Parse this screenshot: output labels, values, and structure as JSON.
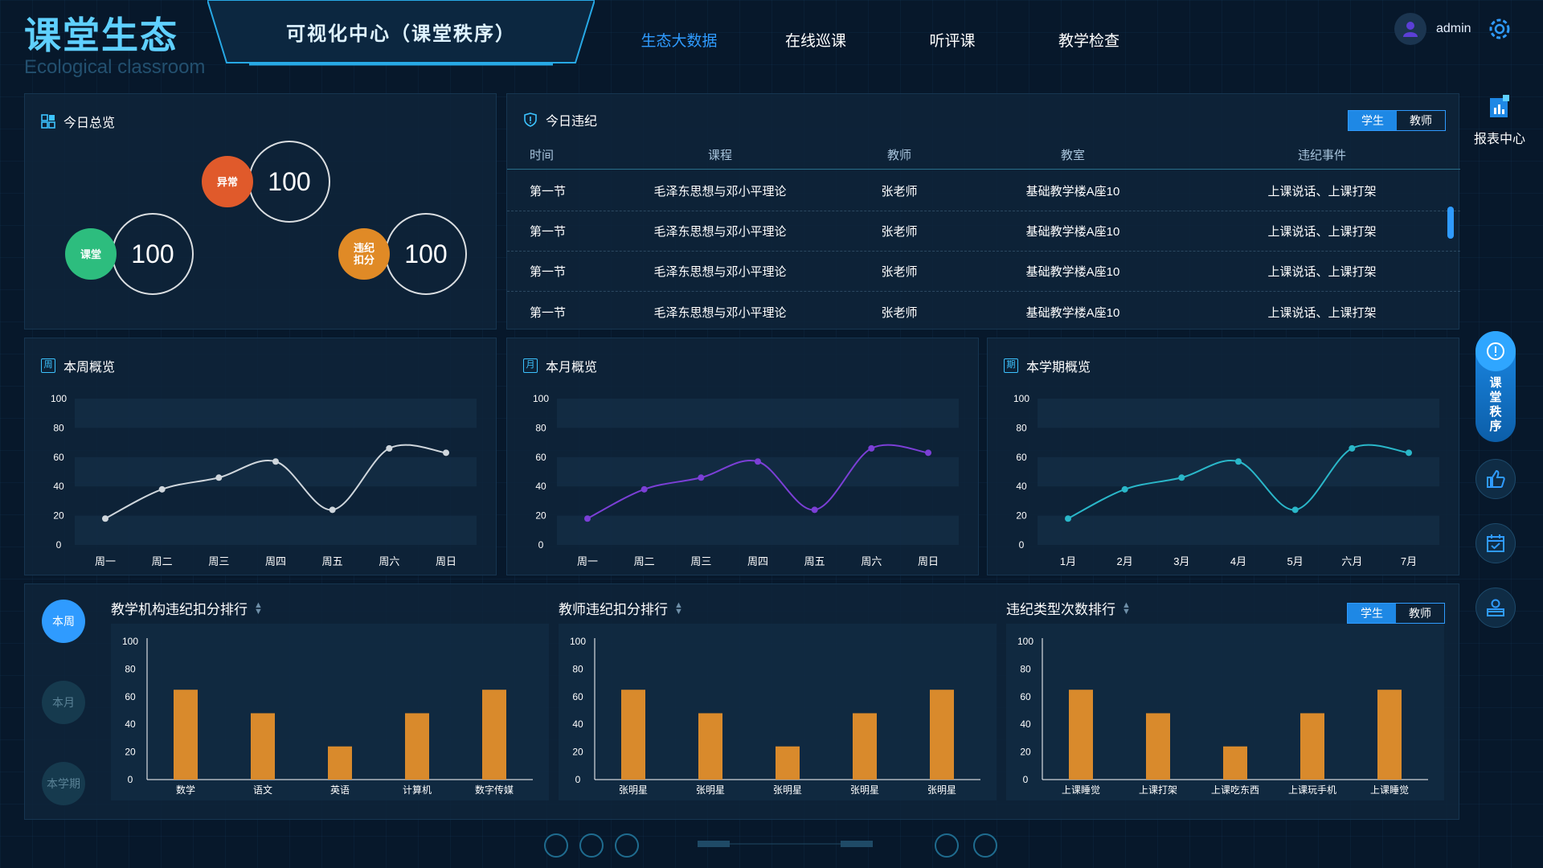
{
  "header": {
    "brand_title": "课堂生态",
    "brand_subtitle": "Ecological classroom",
    "center_title": "可视化中心（课堂秩序）",
    "nav": [
      {
        "label": "生态大数据",
        "active": true
      },
      {
        "label": "在线巡课",
        "active": false
      },
      {
        "label": "听评课",
        "active": false
      },
      {
        "label": "教学检查",
        "active": false
      }
    ],
    "user": {
      "name": "admin",
      "avatar_icon": "user-icon"
    },
    "settings_icon": "gear-icon"
  },
  "overview": {
    "title": "今日总览",
    "items": [
      {
        "label": "异常",
        "value": "100",
        "color": "#e05a2b"
      },
      {
        "label": "课堂",
        "value": "100",
        "color": "#2dbd7e"
      },
      {
        "label": "违纪扣分",
        "value": "100",
        "color": "#e08a26"
      }
    ]
  },
  "violations": {
    "title": "今日违纪",
    "toggle": {
      "options": [
        "学生",
        "教师"
      ],
      "selected": "学生"
    },
    "columns": [
      "时间",
      "课程",
      "教师",
      "教室",
      "违纪事件"
    ],
    "rows": [
      [
        "第一节",
        "毛泽东思想与邓小平理论",
        "张老师",
        "基础教学楼A座10",
        "上课说话、上课打架"
      ],
      [
        "第一节",
        "毛泽东思想与邓小平理论",
        "张老师",
        "基础教学楼A座10",
        "上课说话、上课打架"
      ],
      [
        "第一节",
        "毛泽东思想与邓小平理论",
        "张老师",
        "基础教学楼A座10",
        "上课说话、上课打架"
      ],
      [
        "第一节",
        "毛泽东思想与邓小平理论",
        "张老师",
        "基础教学楼A座10",
        "上课说话、上课打架"
      ]
    ]
  },
  "line_charts": {
    "week": {
      "title": "本周概览",
      "badge": "周"
    },
    "month": {
      "title": "本月概览",
      "badge": "月"
    },
    "term": {
      "title": "本学期概览",
      "badge": "期"
    }
  },
  "bottom": {
    "periods": [
      {
        "label": "本周",
        "active": true
      },
      {
        "label": "本月",
        "active": false
      },
      {
        "label": "本学期",
        "active": false
      }
    ],
    "rankings": [
      {
        "title": "教学机构违纪扣分排行"
      },
      {
        "title": "教师违纪扣分排行"
      },
      {
        "title": "违纪类型次数排行"
      }
    ],
    "toggle": {
      "options": [
        "学生",
        "教师"
      ],
      "selected": "学生"
    }
  },
  "sidebar": {
    "report_label": "报表中心",
    "active_label": "课堂秩序",
    "icons": [
      "report-icon",
      "alert-icon",
      "thumbs-up-icon",
      "calendar-check-icon",
      "teacher-icon"
    ]
  },
  "colors": {
    "accent": "#2f9bff",
    "week_line": "#cfd6dc",
    "month_line": "#7b3fd6",
    "term_line": "#2ab7c9",
    "bar": "#d98a2c"
  },
  "chart_data": [
    {
      "type": "line",
      "title": "本周概览",
      "x": [
        "周一",
        "周二",
        "周三",
        "周四",
        "周五",
        "周六",
        "周日"
      ],
      "series": [
        {
          "values": [
            18,
            38,
            46,
            57,
            24,
            66,
            63
          ]
        }
      ],
      "ylim": [
        0,
        100
      ],
      "yticks": [
        0,
        20,
        40,
        60,
        80,
        100
      ],
      "grid": false
    },
    {
      "type": "line",
      "title": "本月概览",
      "x": [
        "周一",
        "周二",
        "周三",
        "周四",
        "周五",
        "周六",
        "周日"
      ],
      "series": [
        {
          "values": [
            18,
            38,
            46,
            57,
            24,
            66,
            63
          ]
        }
      ],
      "ylim": [
        0,
        100
      ],
      "yticks": [
        0,
        20,
        40,
        60,
        80,
        100
      ],
      "grid": false
    },
    {
      "type": "line",
      "title": "本学期概览",
      "x": [
        "1月",
        "2月",
        "3月",
        "4月",
        "5月",
        "六月",
        "7月"
      ],
      "series": [
        {
          "values": [
            18,
            38,
            46,
            57,
            24,
            66,
            63
          ]
        }
      ],
      "ylim": [
        0,
        100
      ],
      "yticks": [
        0,
        20,
        40,
        60,
        80,
        100
      ],
      "grid": false
    },
    {
      "type": "bar",
      "title": "教学机构违纪扣分排行",
      "categories": [
        "数学",
        "语文",
        "英语",
        "计算机",
        "数字传媒"
      ],
      "values": [
        65,
        48,
        24,
        48,
        65
      ],
      "ylim": [
        0,
        100
      ],
      "yticks": [
        0,
        20,
        40,
        60,
        80,
        100
      ]
    },
    {
      "type": "bar",
      "title": "教师违纪扣分排行",
      "categories": [
        "张明星",
        "张明星",
        "张明星",
        "张明星",
        "张明星"
      ],
      "values": [
        65,
        48,
        24,
        48,
        65
      ],
      "ylim": [
        0,
        100
      ],
      "yticks": [
        0,
        20,
        40,
        60,
        80,
        100
      ]
    },
    {
      "type": "bar",
      "title": "违纪类型次数排行",
      "categories": [
        "上课睡觉",
        "上课打架",
        "上课吃东西",
        "上课玩手机",
        "上课睡觉"
      ],
      "values": [
        65,
        48,
        24,
        48,
        65
      ],
      "ylim": [
        0,
        100
      ],
      "yticks": [
        0,
        20,
        40,
        60,
        80,
        100
      ]
    }
  ]
}
